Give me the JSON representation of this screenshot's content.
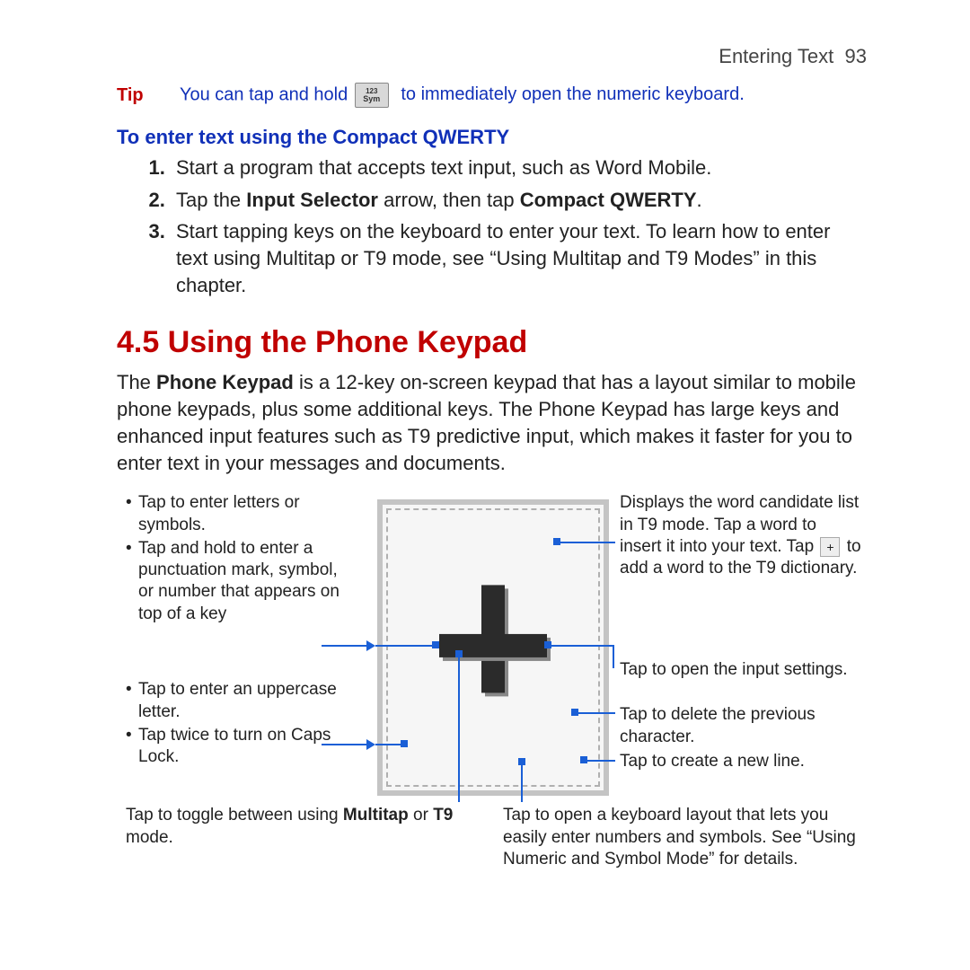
{
  "header": {
    "section": "Entering Text",
    "page_number": "93"
  },
  "tip": {
    "label": "Tip",
    "before": "You can tap and hold",
    "key_top": "123",
    "key_bot": "Sym",
    "after": "to immediately open the numeric keyboard."
  },
  "qwerty": {
    "heading": "To enter text using the Compact QWERTY",
    "step1": "Start a program that accepts text input, such as Word Mobile.",
    "step2_a": "Tap the ",
    "step2_b": "Input Selector",
    "step2_c": " arrow, then tap ",
    "step2_d": "Compact QWERTY",
    "step2_e": ".",
    "step3": "Start tapping keys on the keyboard to enter your text. To learn how to enter text using Multitap or T9 mode, see “Using Multitap and T9 Modes” in this chapter."
  },
  "section": {
    "title": "4.5 Using the Phone Keypad",
    "body_a": "The ",
    "body_b": "Phone Keypad",
    "body_c": " is a 12-key on-screen keypad that has a layout similar to mobile phone keypads, plus some additional keys. The Phone Keypad has large keys and enhanced input features such as T9 predictive input, which makes it faster for you to enter text in your messages and documents."
  },
  "callouts": {
    "left1a": "Tap to enter letters or symbols.",
    "left1b": "Tap and hold to enter a punctuation mark, symbol, or number that appears on top of a key",
    "left2a": "Tap to enter an uppercase letter.",
    "left2b": "Tap twice to turn on Caps Lock.",
    "bottom_left_a": "Tap to toggle between using ",
    "bottom_left_b": "Multitap",
    "bottom_left_c": " or ",
    "bottom_left_d": "T9",
    "bottom_left_e": " mode.",
    "right1_a": "Displays the word candidate list in T9 mode. Tap a word to insert it into your text. Tap",
    "right1_plus": "+",
    "right1_b": "to add a word to the T9 dictionary.",
    "right2": "Tap to open the input settings.",
    "right3": "Tap to delete the previous character.",
    "right4": "Tap to create a new line.",
    "bottom_right": "Tap to open a keyboard layout that lets you easily enter numbers and symbols. See “Using Numeric and Symbol Mode” for details."
  }
}
